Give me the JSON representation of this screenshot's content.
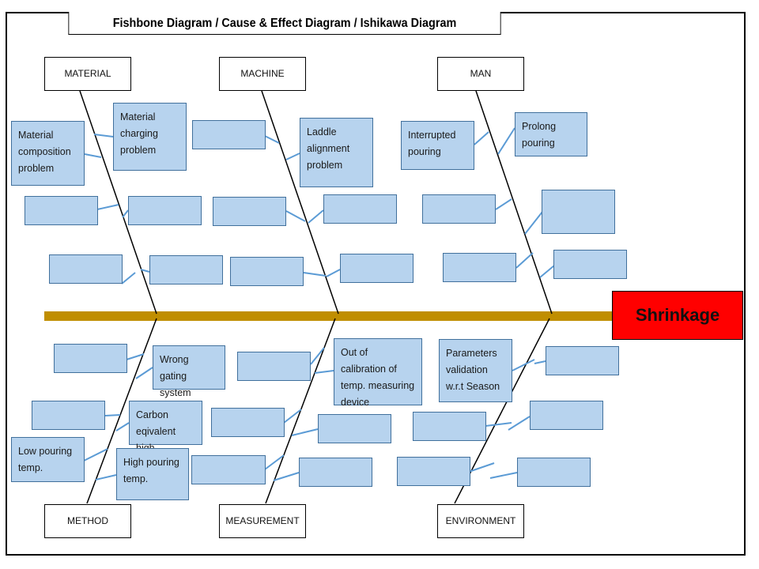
{
  "title": "Fishbone Diagram / Cause & Effect Diagram / Ishikawa Diagram",
  "effect": "Shrinkage",
  "colors": {
    "spine": "#c08e00",
    "cause_fill": "#b7d3ee",
    "cause_border": "#41709c",
    "connector": "#5b9bd5",
    "effect_fill": "#ff0000"
  },
  "categories": {
    "material": "MATERIAL",
    "machine": "MACHINE",
    "man": "MAN",
    "method": "METHOD",
    "measurement": "MEASUREMENT",
    "environment": "ENVIRONMENT"
  },
  "causes": {
    "material": [
      "Material composition problem",
      "Material charging problem",
      "",
      "",
      "",
      ""
    ],
    "machine": [
      "",
      "Laddle alignment problem",
      "",
      "",
      "",
      ""
    ],
    "man": [
      "Interrupted pouring",
      "Prolong pouring",
      "",
      "",
      "",
      ""
    ],
    "method": [
      "",
      "Wrong gating system",
      "",
      "Carbon eqivalent high",
      "Low pouring temp.",
      "High pouring temp."
    ],
    "measurement": [
      "",
      "Out of calibration of temp. measuring device",
      "",
      "",
      "",
      ""
    ],
    "environment": [
      "Parameters validation w.r.t Season",
      "",
      "",
      "",
      "",
      ""
    ]
  }
}
